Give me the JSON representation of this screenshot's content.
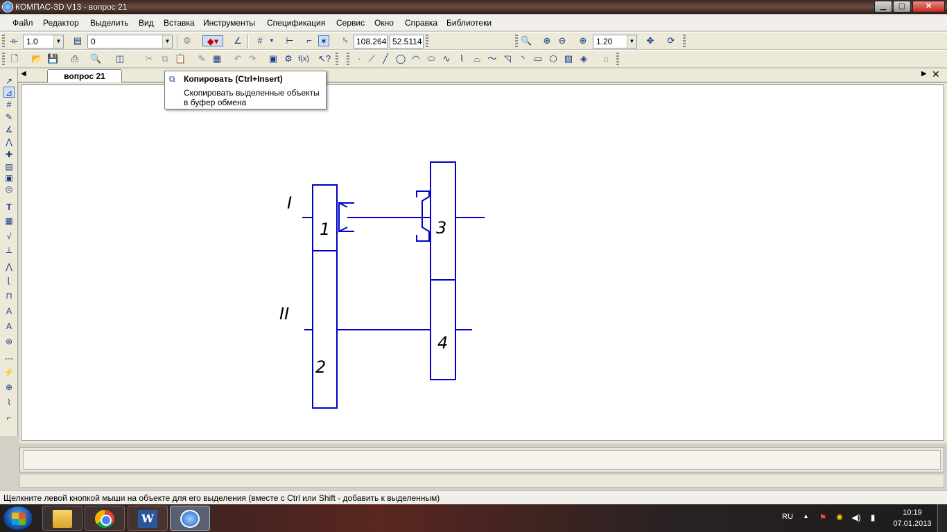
{
  "window": {
    "title": "КОМПАС-3D V13 - вопрос 21",
    "min": "▁",
    "max": "▢",
    "close": "✕"
  },
  "menu": [
    "Файл",
    "Редактор",
    "Выделить",
    "Вид",
    "Вставка",
    "Инструменты",
    "Спецификация",
    "Сервис",
    "Окно",
    "Справка",
    "Библиотеки"
  ],
  "toolbar1": {
    "line_scale": "1.0",
    "layer": "0",
    "coord_x": "108.264",
    "coord_y": "52.5114",
    "zoom": "1.20"
  },
  "tabs": {
    "active": "вопрос 21",
    "scroll_left": "◀",
    "scroll_right": "▶",
    "close": "✕"
  },
  "tooltip": {
    "title": "Копировать (Ctrl+Insert)",
    "description": "Скопировать выделенные объекты в буфер обмена",
    "icon": "copy-icon"
  },
  "drawing": {
    "shaft_labels": [
      "I",
      "II"
    ],
    "gear_labels": [
      "1",
      "2",
      "3",
      "4"
    ],
    "line_color": "#0000c8"
  },
  "status": {
    "text": "Щелкните левой кнопкой мыши на объекте для его выделения (вместе с Ctrl или Shift - добавить к выделенным)"
  },
  "taskbar": {
    "language": "RU",
    "time": "10:19",
    "date": "07.01.2013",
    "apps": [
      "explorer",
      "chrome",
      "word",
      "kompas"
    ]
  }
}
